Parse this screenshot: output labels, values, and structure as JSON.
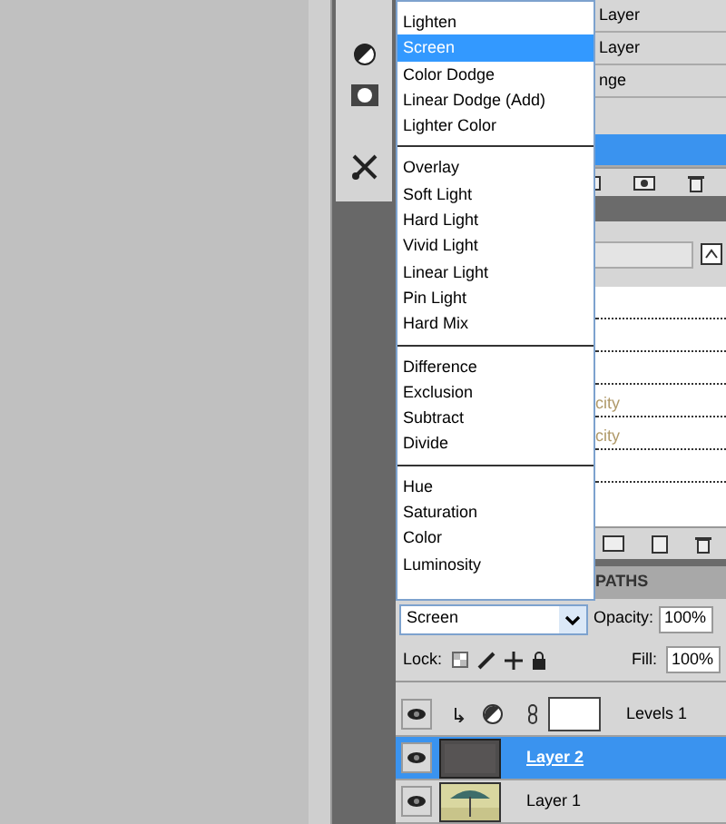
{
  "upper_panel": {
    "fragments": [
      {
        "label": "Layer",
        "selected": false
      },
      {
        "label": "Layer",
        "selected": false
      },
      {
        "label": "nge",
        "selected": false
      },
      {
        "selected": true
      }
    ]
  },
  "middle_panel": {
    "fragments": [
      "city",
      "city"
    ]
  },
  "blend_menu": {
    "groups": [
      {
        "items": [
          {
            "label": "Lighten",
            "selected": false
          },
          {
            "label": "Screen",
            "selected": true
          },
          {
            "label": "Color Dodge",
            "selected": false
          },
          {
            "label": "Linear Dodge (Add)",
            "selected": false
          },
          {
            "label": "Lighter Color",
            "selected": false
          }
        ]
      },
      {
        "items": [
          {
            "label": "Overlay",
            "selected": false
          },
          {
            "label": "Soft Light",
            "selected": false
          },
          {
            "label": "Hard Light",
            "selected": false
          },
          {
            "label": "Vivid Light",
            "selected": false
          },
          {
            "label": "Linear Light",
            "selected": false
          },
          {
            "label": "Pin Light",
            "selected": false
          },
          {
            "label": "Hard Mix",
            "selected": false
          }
        ]
      },
      {
        "items": [
          {
            "label": "Difference",
            "selected": false
          },
          {
            "label": "Exclusion",
            "selected": false
          },
          {
            "label": "Subtract",
            "selected": false
          },
          {
            "label": "Divide",
            "selected": false
          }
        ]
      },
      {
        "items": [
          {
            "label": "Hue",
            "selected": false
          },
          {
            "label": "Saturation",
            "selected": false
          },
          {
            "label": "Color",
            "selected": false
          },
          {
            "label": "Luminosity",
            "selected": false
          }
        ]
      }
    ]
  },
  "layers_panel": {
    "tab": "PATHS",
    "blend_mode": "Screen",
    "opacity_label": "Opacity:",
    "opacity": "100%",
    "lock_label": "Lock:",
    "fill_label": "Fill:",
    "fill": "100%",
    "layers": [
      {
        "kind": "adjustment",
        "name": "Levels 1",
        "selected": false,
        "visible": true
      },
      {
        "kind": "pixel",
        "name": "Layer 2",
        "selected": true,
        "visible": true
      },
      {
        "name": "Layer 1",
        "selected": false,
        "visible": true
      }
    ]
  }
}
